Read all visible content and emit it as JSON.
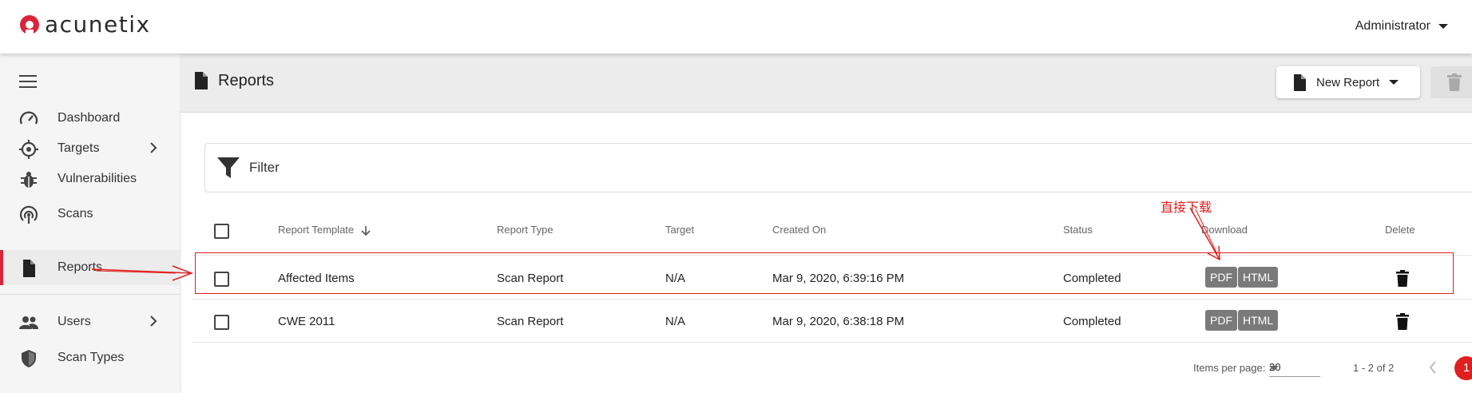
{
  "app": {
    "logo_text": "acunetix",
    "user_menu": "Administrator",
    "brand_color": "#d9243b"
  },
  "sidebar": {
    "items": [
      {
        "label": "Dashboard",
        "icon": "speedometer-icon"
      },
      {
        "label": "Targets",
        "icon": "crosshair-icon",
        "has_submenu": true
      },
      {
        "label": "Vulnerabilities",
        "icon": "bug-icon"
      },
      {
        "label": "Scans",
        "icon": "radar-icon"
      },
      {
        "label": "Reports",
        "icon": "document-icon",
        "active": true
      },
      {
        "label": "Users",
        "icon": "people-icon",
        "has_submenu": true
      },
      {
        "label": "Scan Types",
        "icon": "shield-icon"
      }
    ]
  },
  "page": {
    "title": "Reports",
    "new_report_label": "New Report",
    "filter_label": "Filter"
  },
  "table": {
    "columns": [
      "Report Template",
      "Report Type",
      "Target",
      "Created On",
      "Status",
      "Download",
      "Delete"
    ],
    "rows": [
      {
        "template": "Affected Items",
        "type": "Scan Report",
        "target": "N/A",
        "created_on": "Mar 9, 2020, 6:39:16 PM",
        "status": "Completed",
        "downloads": [
          "PDF",
          "HTML"
        ]
      },
      {
        "template": "CWE 2011",
        "type": "Scan Report",
        "target": "N/A",
        "created_on": "Mar 9, 2020, 6:38:18 PM",
        "status": "Completed",
        "downloads": [
          "PDF",
          "HTML"
        ]
      }
    ]
  },
  "pagination": {
    "items_per_page_label": "Items per page:",
    "items_per_page": "20",
    "range": "1 - 2 of 2"
  },
  "annotation": {
    "text": "直接下载",
    "color": "#e02020"
  },
  "notification_count": "1"
}
